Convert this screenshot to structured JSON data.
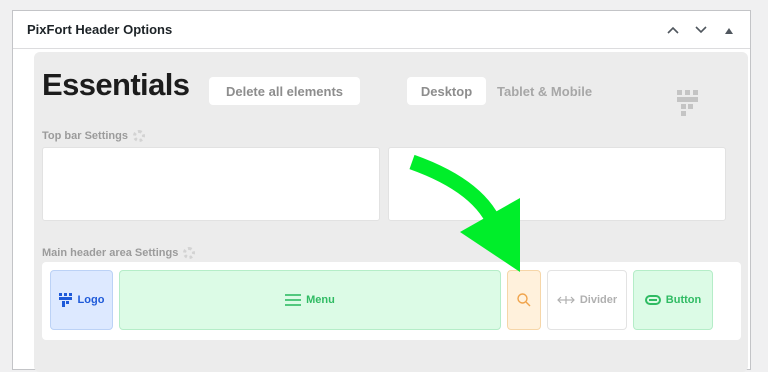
{
  "metabox": {
    "title": "PixFort Header Options",
    "controls": [
      "chevron-up-icon",
      "chevron-down-icon",
      "triangle-up-icon"
    ]
  },
  "builder": {
    "heading": "Essentials",
    "delete_label": "Delete all elements",
    "tabs": [
      "Desktop",
      "Tablet & Mobile"
    ],
    "topbar_label": "Top bar Settings",
    "main_label": "Main header area Settings"
  },
  "elements": {
    "logo": "Logo",
    "menu": "Menu",
    "divider": "Divider",
    "button": "Button"
  },
  "colors": {
    "arrow": "#00ee2a",
    "logo": "#1e5ad9",
    "green": "#2fbb63",
    "search": "#f0a34a"
  }
}
